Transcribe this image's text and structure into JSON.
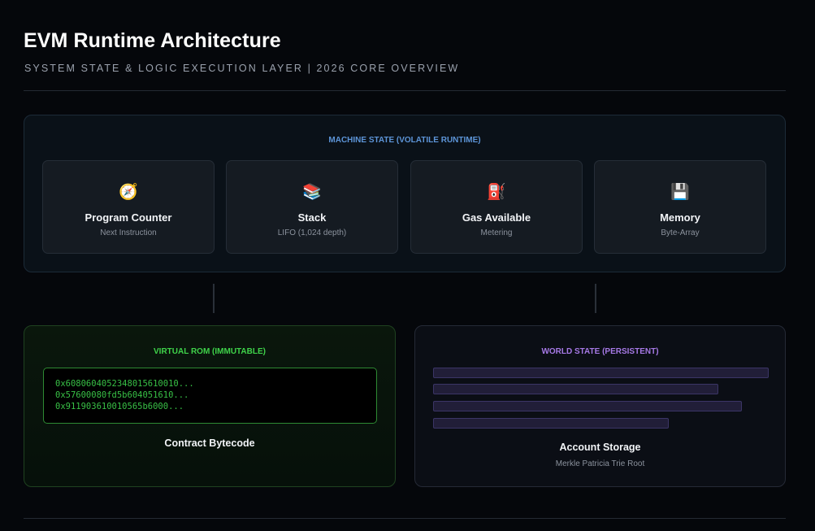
{
  "header": {
    "title": "EVM Runtime Architecture",
    "subtitle": "SYSTEM STATE & LOGIC EXECUTION LAYER | 2026 CORE OVERVIEW"
  },
  "machine_state": {
    "label": "MACHINE STATE (VOLATILE RUNTIME)",
    "components": [
      {
        "icon": "compass-icon",
        "glyph": "🧭",
        "name": "Program Counter",
        "desc": "Next Instruction"
      },
      {
        "icon": "books-icon",
        "glyph": "📚",
        "name": "Stack",
        "desc": "LIFO (1,024 depth)"
      },
      {
        "icon": "fuel-pump-icon",
        "glyph": "⛽",
        "name": "Gas Available",
        "desc": "Metering"
      },
      {
        "icon": "floppy-disk-icon",
        "glyph": "💾",
        "name": "Memory",
        "desc": "Byte-Array"
      }
    ]
  },
  "virtual_rom": {
    "label": "VIRTUAL ROM (IMMUTABLE)",
    "bytecode_lines": [
      "0x6080604052348015610010...",
      "0x57600080fd5b604051610...",
      "0x911903610010565b6000..."
    ],
    "name": "Contract Bytecode"
  },
  "world_state": {
    "label": "WORLD STATE (PERSISTENT)",
    "name": "Account Storage",
    "desc": "Merkle Patricia Trie Root"
  },
  "colors": {
    "background": "#05070b",
    "machine_accent": "#5d95d8",
    "rom_accent": "#3fd34a",
    "world_accent": "#a679e6"
  }
}
